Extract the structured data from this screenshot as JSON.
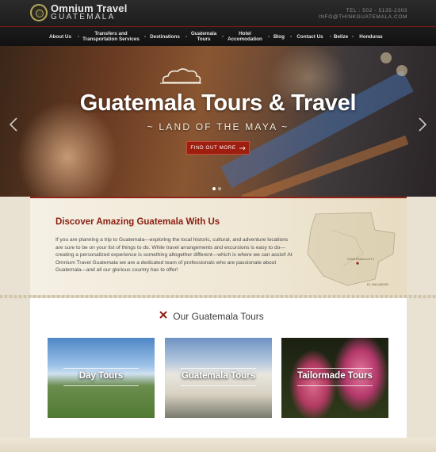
{
  "header": {
    "brand_line1": "Omnium Travel",
    "brand_line2": "GUATEMALA",
    "phone": "TEL : 502 - 5135-2303",
    "email": "INFO@THINKGUATEMALA.COM"
  },
  "nav": {
    "items": [
      {
        "label": "About Us"
      },
      {
        "label": "Transfers and Transportation Services"
      },
      {
        "label": "Destinations"
      },
      {
        "label": "Guatemala Tours"
      },
      {
        "label": "Hotel Accomodation"
      },
      {
        "label": "Blog"
      },
      {
        "label": "Contact Us"
      },
      {
        "label": "Belize"
      },
      {
        "label": "Honduras"
      }
    ]
  },
  "hero": {
    "title": "Guatemala Tours & Travel",
    "subtitle": "~ LAND OF THE MAYA ~",
    "cta_label": "FIND OUT MORE",
    "slide_count": 2,
    "active_slide": 1
  },
  "intro": {
    "title": "Discover Amazing Guatemala With Us",
    "text": "If you are planning a trip to Guatemala—exploring the local historic, cultural, and adventure locations are sure to be on your list of things to do. While travel arrangements and excursions is easy to do—creating a personalized experience is something altogether different—which is where we can assist! At Omnium Travel Guatemala we are a dedicated team of professionals who are passionate about Guatemala—and all our glorious country has to offer!",
    "map_labels": {
      "guatemala_city": "GUATEMALA CITY",
      "el_salvador": "EL SALVADOR"
    }
  },
  "tours": {
    "title": "Our Guatemala Tours",
    "cards": [
      {
        "label": "Day Tours"
      },
      {
        "label": "Guatemala Tours"
      },
      {
        "label": "Tailormade Tours"
      }
    ]
  },
  "colors": {
    "accent": "#8a1f12",
    "nav_bg": "#151515",
    "cta_bg": "#9e1f10"
  }
}
